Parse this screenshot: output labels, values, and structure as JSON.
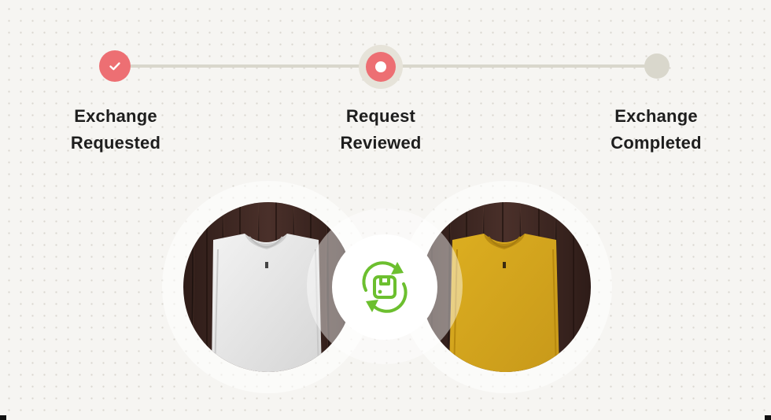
{
  "colors": {
    "accent": "#ed6f73",
    "accent_ring": "#e6e3d9",
    "track": "#d9d7cc",
    "pending": "#d9d7cc",
    "exchange_icon": "#6cbf2f",
    "old_shirt": "#e6e6e6",
    "new_shirt": "#d9a81e",
    "wood": "#3a2520"
  },
  "steps": [
    {
      "line1": "Exchange",
      "line2": "Requested",
      "state": "completed",
      "icon": "check-icon"
    },
    {
      "line1": "Request",
      "line2": "Reviewed",
      "state": "current",
      "icon": "current-step-icon"
    },
    {
      "line1": "Exchange",
      "line2": "Completed",
      "state": "pending",
      "icon": "pending-step-icon"
    }
  ],
  "products": {
    "original": {
      "item": "t-shirt",
      "color": "white"
    },
    "replacement": {
      "item": "t-shirt",
      "color": "yellow"
    },
    "exchange_icon": "exchange-cycle-icon"
  }
}
